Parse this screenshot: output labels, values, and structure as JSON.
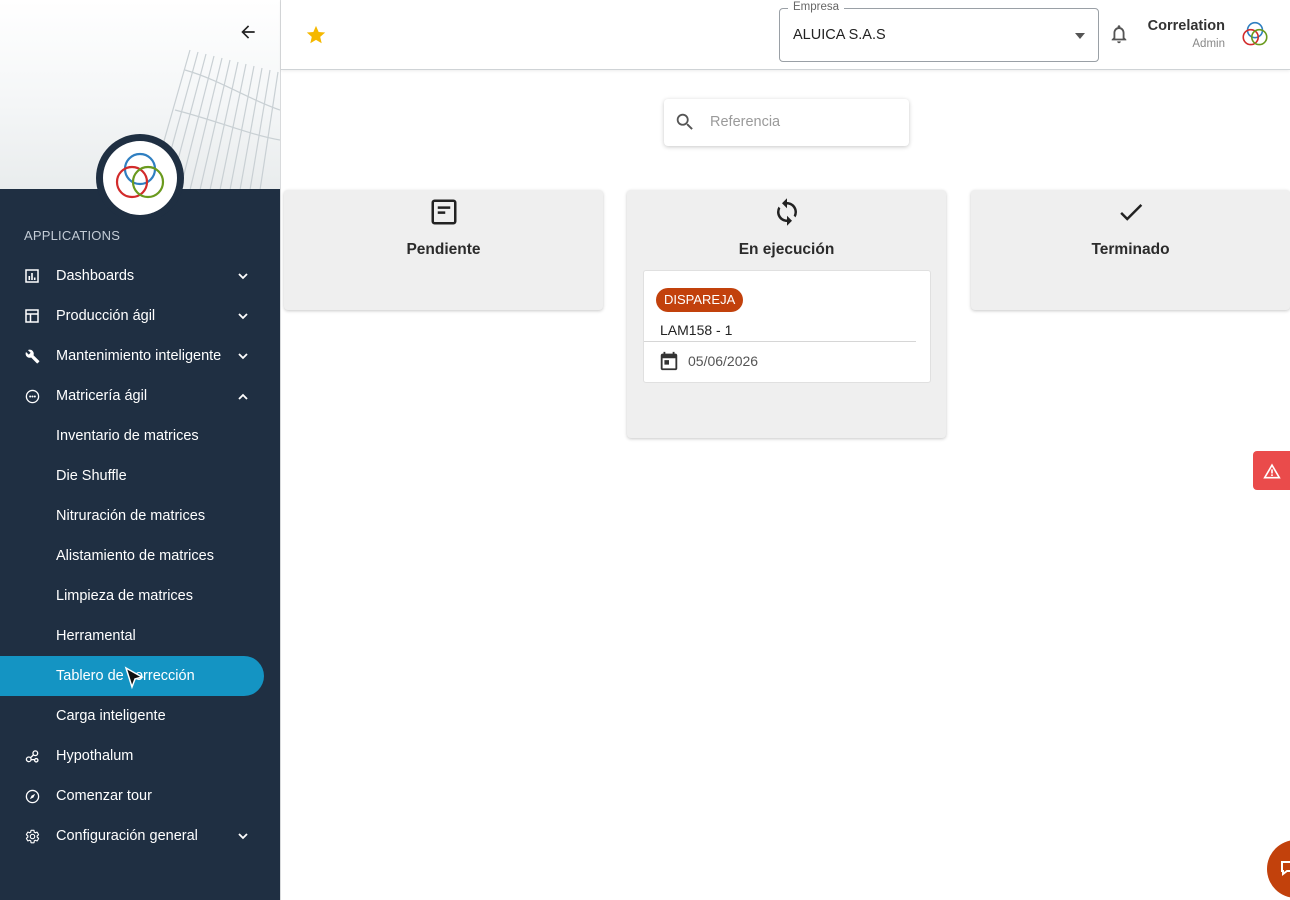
{
  "sidebar": {
    "applications_label": "APPLICATIONS",
    "items": [
      {
        "label": "Dashboards",
        "icon": "bar-chart-icon",
        "chevron": "down"
      },
      {
        "label": "Producción ágil",
        "icon": "table-chart-icon",
        "chevron": "down"
      },
      {
        "label": "Mantenimiento inteligente",
        "icon": "wrench-icon",
        "chevron": "down"
      },
      {
        "label": "Matricería ágil",
        "icon": "die-icon",
        "chevron": "up"
      },
      {
        "label": "Inventario de matrices"
      },
      {
        "label": "Die Shuffle"
      },
      {
        "label": "Nitruración de matrices"
      },
      {
        "label": "Alistamiento de matrices"
      },
      {
        "label": "Limpieza de matrices"
      },
      {
        "label": "Herramental"
      },
      {
        "label": "Tablero de corrección",
        "active": true
      },
      {
        "label": "Carga inteligente"
      },
      {
        "label": "Hypothalum",
        "icon": "hub-icon"
      },
      {
        "label": "Comenzar tour",
        "icon": "compass-icon"
      },
      {
        "label": "Configuración general",
        "icon": "gear-icon",
        "chevron": "down"
      }
    ]
  },
  "header": {
    "empresa_label": "Empresa",
    "empresa_value": "ALUICA S.A.S",
    "user_name": "Correlation",
    "user_role": "Admin"
  },
  "search": {
    "placeholder": "Referencia"
  },
  "columns": [
    {
      "title": "Pendiente",
      "icon": "article-icon"
    },
    {
      "title": "En ejecución",
      "icon": "sync-icon"
    },
    {
      "title": "Terminado",
      "icon": "check-icon"
    }
  ],
  "card": {
    "chip": "DISPAREJA",
    "reference": "LAM158 - 1",
    "date": "05/06/2026"
  },
  "colors": {
    "sidebar_bg": "#1f2f42",
    "active_item": "#1494c3",
    "chip": "#c2410c",
    "alert": "#ea4b4b",
    "star": "#f5b800"
  }
}
